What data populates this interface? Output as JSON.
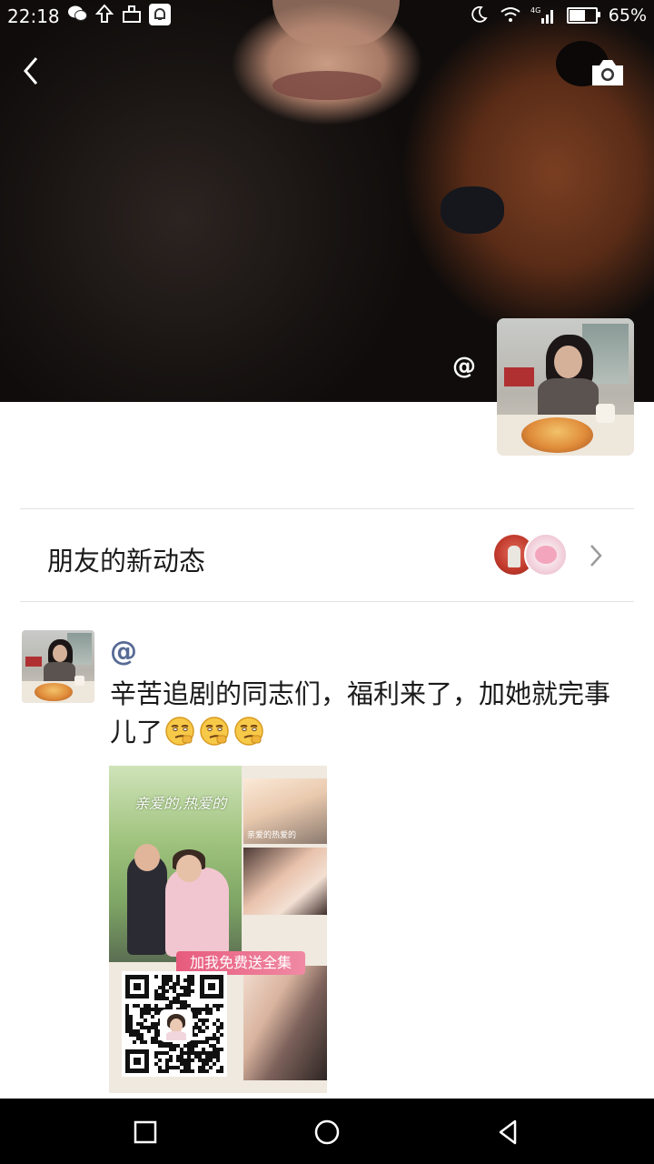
{
  "status_bar": {
    "time": "22:18",
    "battery_percent": "65%",
    "battery_level": 0.65,
    "network": "4G",
    "left_icons": [
      "wechat-icon",
      "upload-icon",
      "share-icon",
      "bell-icon"
    ],
    "right_icons": [
      "moon-icon",
      "wifi-icon",
      "signal-icon",
      "battery-icon"
    ]
  },
  "header": {
    "back_icon": "chevron-left-icon",
    "camera_icon": "camera-icon",
    "profile_name": "@"
  },
  "friends_updates": {
    "label": "朋友的新动态",
    "avatars": [
      "friend-avatar-man",
      "friend-avatar-pig"
    ]
  },
  "post": {
    "author": "@",
    "text": "辛苦追剧的同志们，福利来了，加她就完事儿了",
    "emoji_count": 3,
    "image": {
      "poster_title": "亲爱的,热爱的",
      "banner": "加我免费送全集",
      "still_caption": "亲爱的热爱的"
    }
  },
  "nav_bar": {
    "buttons": [
      "recent-apps-icon",
      "home-icon",
      "back-triangle-icon"
    ]
  },
  "colors": {
    "name_link": "#576b95",
    "separator": "#e2e2e2",
    "banner": "#e75b7d"
  }
}
